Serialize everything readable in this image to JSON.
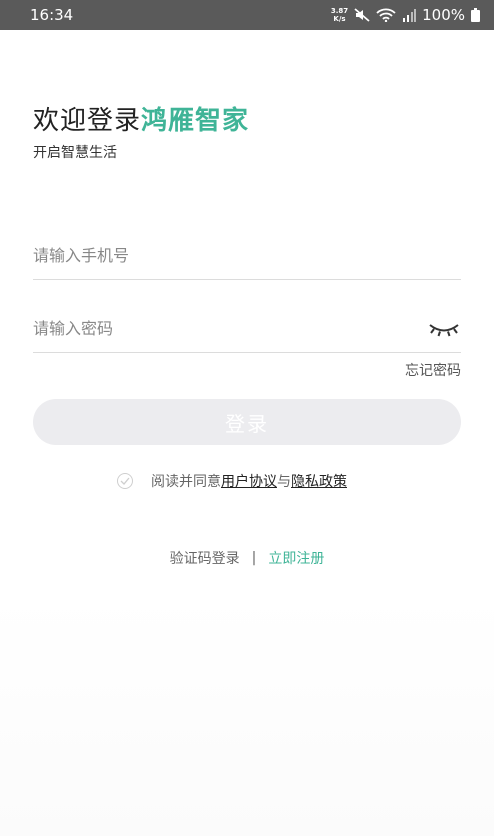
{
  "status_bar": {
    "time": "16:34",
    "net_speed_value": "3.87",
    "net_speed_unit": "K/s",
    "battery": "100%",
    "icons": [
      "mute-icon",
      "wifi-icon",
      "signal-icon",
      "battery-icon"
    ]
  },
  "header": {
    "title_prefix": "欢迎登录",
    "brand_name": "鸿雁智家",
    "subtitle": "开启智慧生活"
  },
  "form": {
    "phone_placeholder": "请输入手机号",
    "phone_value": "",
    "password_placeholder": "请输入密码",
    "password_value": "",
    "forgot_label": "忘记密码",
    "login_label": "登录"
  },
  "agreement": {
    "prefix": "阅读并同意",
    "user_agreement": "用户协议",
    "and": "与",
    "privacy_policy": "隐私政策",
    "checked": false
  },
  "bottom": {
    "sms_login": "验证码登录",
    "separator": "|",
    "register": "立即注册"
  },
  "colors": {
    "brand": "#3fb497",
    "button_disabled": "#ececef",
    "status_bar": "#5a5a5a"
  }
}
